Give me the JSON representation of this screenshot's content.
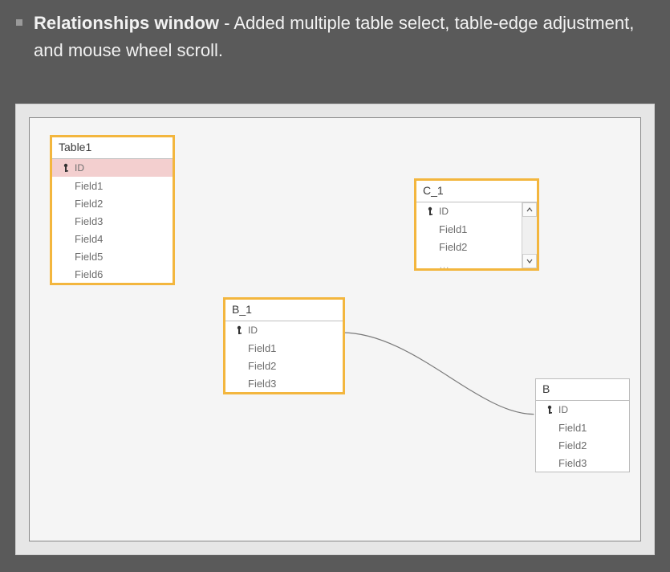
{
  "header": {
    "bold": "Relationships window",
    "rest": " - Added multiple table select, table-edge adjustment, and mouse wheel scroll."
  },
  "tables": {
    "table1": {
      "title": "Table1",
      "key_label": "ID",
      "fields": [
        "Field1",
        "Field2",
        "Field3",
        "Field4",
        "Field5",
        "Field6"
      ]
    },
    "b1": {
      "title": "B_1",
      "key_label": "ID",
      "fields": [
        "Field1",
        "Field2",
        "Field3"
      ]
    },
    "c1": {
      "title": "C_1",
      "key_label": "ID",
      "fields": [
        "Field1",
        "Field2"
      ],
      "overflow_hint": "…"
    },
    "b": {
      "title": "B",
      "key_label": "ID",
      "fields": [
        "Field1",
        "Field2",
        "Field3"
      ]
    }
  }
}
